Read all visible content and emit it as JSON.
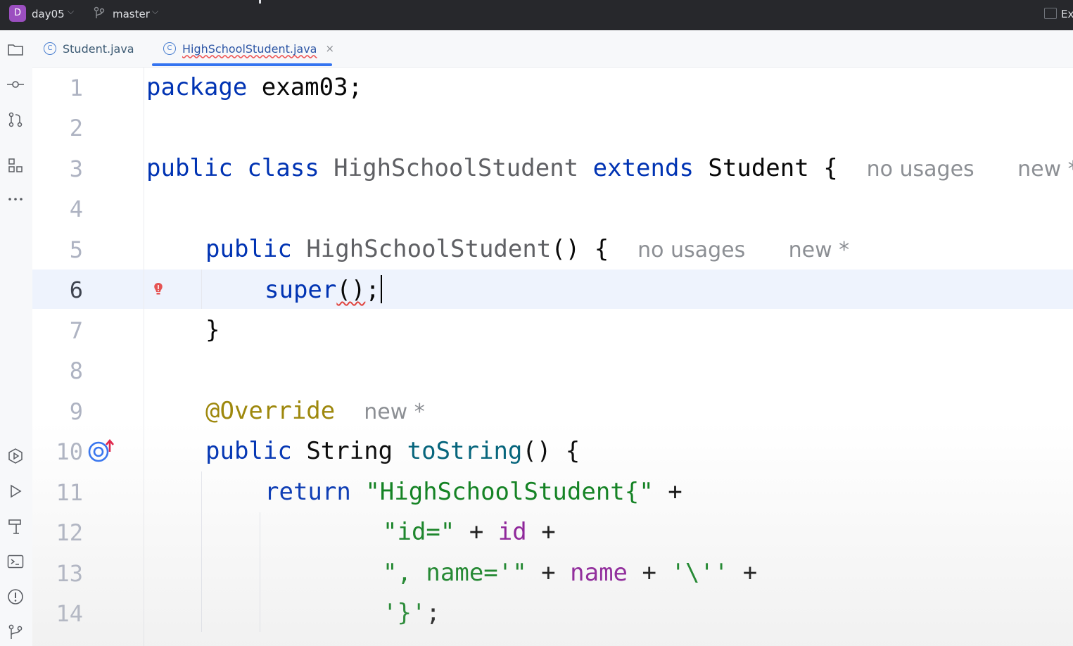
{
  "titlebar": {
    "project_badge": "D",
    "project_name": "day05",
    "branch_name": "master",
    "right_text": "Ex"
  },
  "tabs": [
    {
      "label": "Student.java",
      "active": false
    },
    {
      "label": "HighSchoolStudent.java",
      "active": true,
      "close": "×"
    }
  ],
  "toolstrip_icons": [
    "folder-icon",
    "commit-icon",
    "pull-request-icon",
    "structure-icon",
    "more-icon",
    "services-icon",
    "run-icon",
    "build-icon",
    "terminal-icon",
    "problems-icon",
    "git-icon"
  ],
  "editor": {
    "line_numbers": [
      "1",
      "2",
      "3",
      "4",
      "5",
      "6",
      "7",
      "8",
      "9",
      "10",
      "11",
      "12",
      "13",
      "14"
    ],
    "current_line": "6",
    "lines": {
      "l1": {
        "kw": "package",
        "rest": " exam03;"
      },
      "l3": {
        "kw1": "public",
        "kw2": "class",
        "cls": "HighSchoolStudent",
        "kw3": "extends",
        "typ": "Student",
        "brace": " {",
        "hint1": "no usages",
        "hint2": "new *"
      },
      "l5": {
        "kw": "public",
        "cls": "HighSchoolStudent",
        "rest": "() {",
        "hint1": "no usages",
        "hint2": "new *"
      },
      "l6": {
        "kw": "super",
        "paren": "()",
        "semi": ";"
      },
      "l7": {
        "brace": "}"
      },
      "l9": {
        "ann": "@Override",
        "hint": "new *"
      },
      "l10": {
        "kw": "public",
        "typ": "String",
        "mth": "toString",
        "rest": "() {"
      },
      "l11": {
        "kw": "return",
        "str": "\"HighSchoolStudent{\"",
        "op": " +"
      },
      "l12": {
        "str": "\"id=\"",
        "op1": " + ",
        "fld": "id",
        "op2": " +"
      },
      "l13": {
        "str1": "\", name='\"",
        "op1": " + ",
        "fld": "name",
        "op2": " + ",
        "str2": "'\\''",
        "op3": " +"
      },
      "l14": {
        "str": "'}'",
        "semi": ";"
      }
    }
  }
}
